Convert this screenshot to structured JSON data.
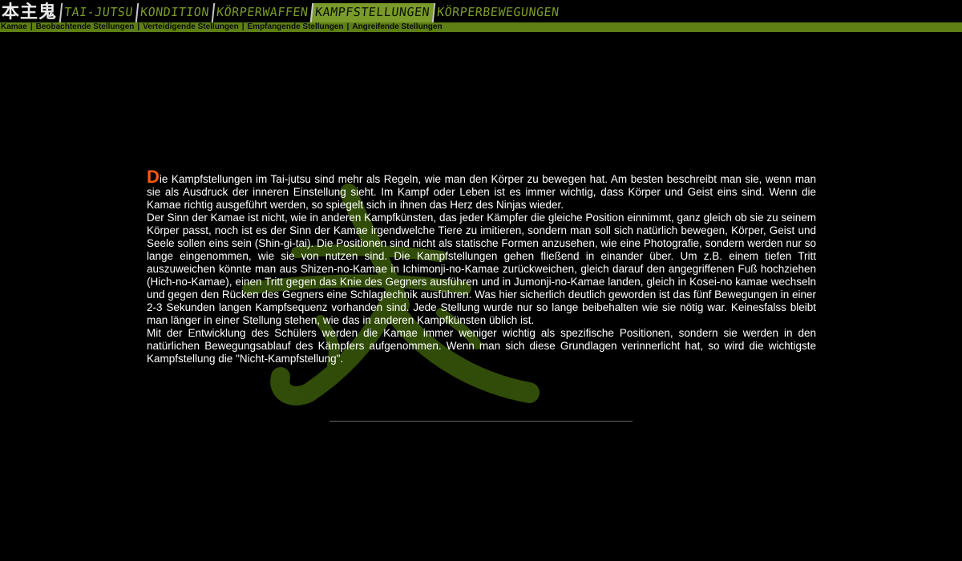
{
  "header": {
    "logo_text": "本主鬼",
    "tabs": [
      {
        "label": "Tai-Jutsu"
      },
      {
        "label": "Kondition"
      },
      {
        "label": "Körperwaffen"
      },
      {
        "label": "Kampfstellungen"
      },
      {
        "label": "Körperbewegungen"
      }
    ],
    "active_tab": "Kampfstellungen"
  },
  "subnav": {
    "items": [
      "Kamae",
      "Beobachtende Stellungen",
      "Verteidigende Stellungen",
      "Empfangende Stellungen",
      "Angreifende Stellungen"
    ],
    "separator": "|"
  },
  "content": {
    "dropcap": "D",
    "para1_rest": "ie Kampfstellungen im Tai-jutsu sind mehr als Regeln, wie man den Körper zu bewegen hat. Am besten beschreibt man sie, wenn man sie als Ausdruck der inneren Einstellung sieht. Im Kampf oder Leben ist es immer wichtig, dass Körper und Geist eins sind. Wenn die Kamae richtig ausgeführt werden, so spiegelt sich in ihnen das Herz des Ninjas wieder.",
    "para2": "Der Sinn der Kamae ist nicht, wie in anderen Kampfkünsten, das jeder Kämpfer die gleiche Position einnimmt, ganz gleich ob sie zu seinem Körper passt, noch ist es der Sinn der Kamae irgendwelche Tiere zu imitieren, sondern man soll sich natürlich bewegen, Körper, Geist und Seele sollen eins sein (Shin-gi-tai). Die Positionen sind nicht als statische Formen anzusehen, wie eine Photografie, sondern werden nur so lange eingenommen, wie sie von nutzen sind. Die Kampfstellungen gehen fließend in einander über. Um z.B. einem tiefen Tritt auszuweichen könnte man aus Shizen-no-Kamae in Ichimonji-no-Kamae zurückweichen, gleich darauf den angegriffenen Fuß hochziehen (Hich-no-Kamae), einen Tritt gegen das Knie des Gegners ausführen und in Jumonji-no-Kamae landen, gleich in Kosei-no kamae wechseln und gegen den Rücken des Gegners eine Schlagtechnik ausführen. Was hier sicherlich deutlich geworden ist das fünf Bewegungen in einer 2-3 Sekunden langen Kampfsequenz vorhanden sind. Jede Stellung wurde nur so lange beibehalten wie sie nötig war. Keinesfalss bleibt man länger in einer Stellung stehen, wie das in anderen Kampfkünsten üblich ist.",
    "para3": "Mit der Entwicklung des Schülers werden die Kamae immer weniger wichtig als spezifische Positionen, sondern sie werden in den natürlichen Bewegungsablauf des Kämpfers aufgenommen. Wenn man sich diese Grundlagen verinnerlicht hat, so wird die wichtigste Kampfstellung die \"Nicht-Kampfstellung\"."
  },
  "colors": {
    "background": "#000000",
    "accent_green": "#5d7f14",
    "tab_green": "#7a9a2a",
    "dropcap_orange": "#ff5a14",
    "text": "#ffffff"
  },
  "icons": {
    "watermark": "calligraphy-brush-stroke-watermark"
  }
}
